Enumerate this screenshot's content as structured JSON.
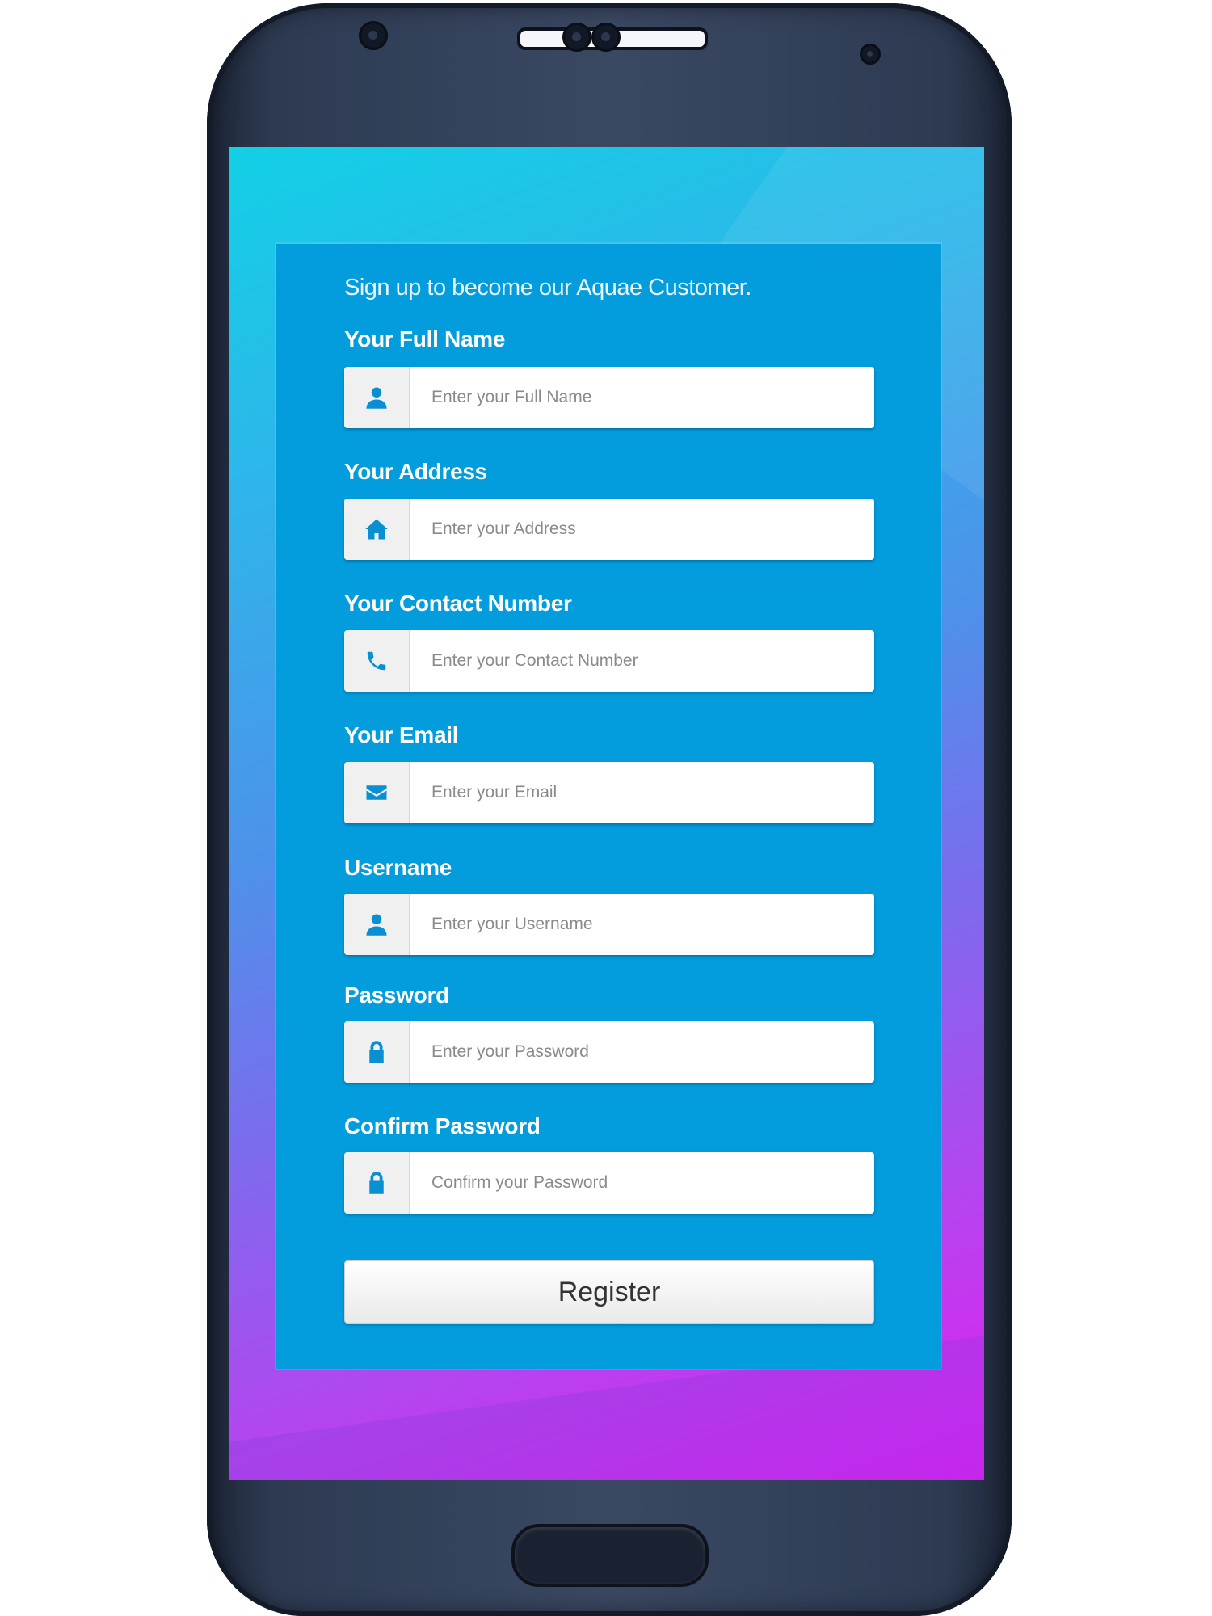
{
  "form": {
    "intro": "Sign up to become our Aquae Customer.",
    "fields": [
      {
        "label": "Your Full Name",
        "placeholder": "Enter your Full Name",
        "icon": "user-icon"
      },
      {
        "label": "Your Address",
        "placeholder": "Enter your Address",
        "icon": "home-icon"
      },
      {
        "label": "Your Contact Number",
        "placeholder": "Enter your Contact Number",
        "icon": "phone-icon"
      },
      {
        "label": "Your Email",
        "placeholder": "Enter your Email",
        "icon": "envelope-icon"
      },
      {
        "label": "Username",
        "placeholder": "Enter your Username",
        "icon": "user-icon"
      },
      {
        "label": "Password",
        "placeholder": "Enter your Password",
        "icon": "lock-icon"
      },
      {
        "label": "Confirm Password",
        "placeholder": "Confirm your Password",
        "icon": "lock-icon"
      }
    ],
    "register_label": "Register"
  },
  "colors": {
    "panel": "#039cdc",
    "icon": "#0a8fd2",
    "screen_gradient_start": "#12d0e6",
    "screen_gradient_end": "#e11ff0"
  }
}
